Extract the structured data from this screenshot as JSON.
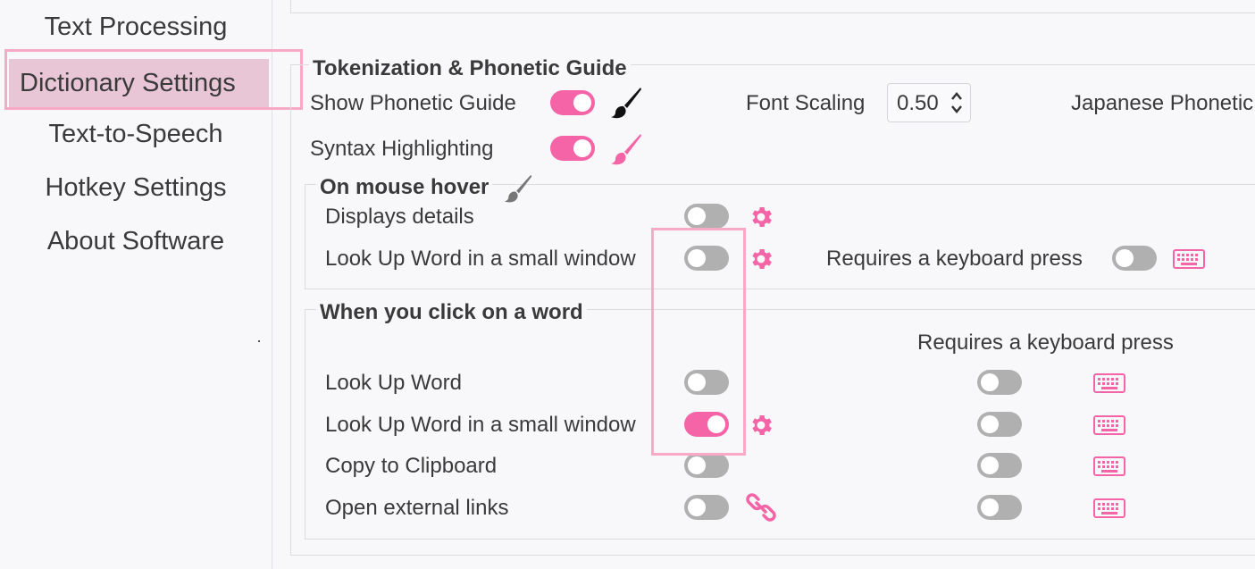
{
  "sidebar": {
    "items": [
      {
        "label": "Text Processing",
        "active": false
      },
      {
        "label": "Dictionary Settings",
        "active": true
      },
      {
        "label": "Text-to-Speech",
        "active": false
      },
      {
        "label": "Hotkey Settings",
        "active": false
      },
      {
        "label": "About Software",
        "active": false
      }
    ]
  },
  "tokenization": {
    "title": "Tokenization & Phonetic Guide",
    "show_phonetic_guide": {
      "label": "Show Phonetic Guide",
      "on": true,
      "icon": "brush-icon-black"
    },
    "syntax_highlighting": {
      "label": "Syntax Highlighting",
      "on": true,
      "icon": "brush-icon-pink"
    },
    "font_scaling": {
      "label": "Font Scaling",
      "value": "0.50"
    },
    "japanese_phonetic": {
      "label": "Japanese Phonetic"
    }
  },
  "mouse_hover": {
    "title": "On mouse hover",
    "title_icon": "brush-icon-gray",
    "displays_details": {
      "label": "Displays details",
      "on": false,
      "icon": "gear-icon"
    },
    "lookup_small": {
      "label": "Look Up Word in a small window",
      "on": false,
      "icon": "gear-icon"
    },
    "requires_keyboard": {
      "label": "Requires a keyboard press",
      "on": false,
      "icon": "keyboard-icon"
    }
  },
  "click_word": {
    "title": "When you click on a word",
    "requires_keyboard_header": "Requires a keyboard press",
    "rows": [
      {
        "label": "Look Up Word",
        "on": false,
        "icon": "",
        "key_on": false
      },
      {
        "label": "Look Up Word in a small window",
        "on": true,
        "icon": "gear-icon",
        "key_on": false
      },
      {
        "label": "Copy to Clipboard",
        "on": false,
        "icon": "",
        "key_on": false
      },
      {
        "label": "Open external links",
        "on": false,
        "icon": "link-icon",
        "key_on": false
      }
    ]
  },
  "colors": {
    "accent": "#f564a6",
    "toggle_off": "#b0b0b0",
    "active_bg": "#e8c6d5",
    "highlight_border": "#f7a9c6"
  }
}
